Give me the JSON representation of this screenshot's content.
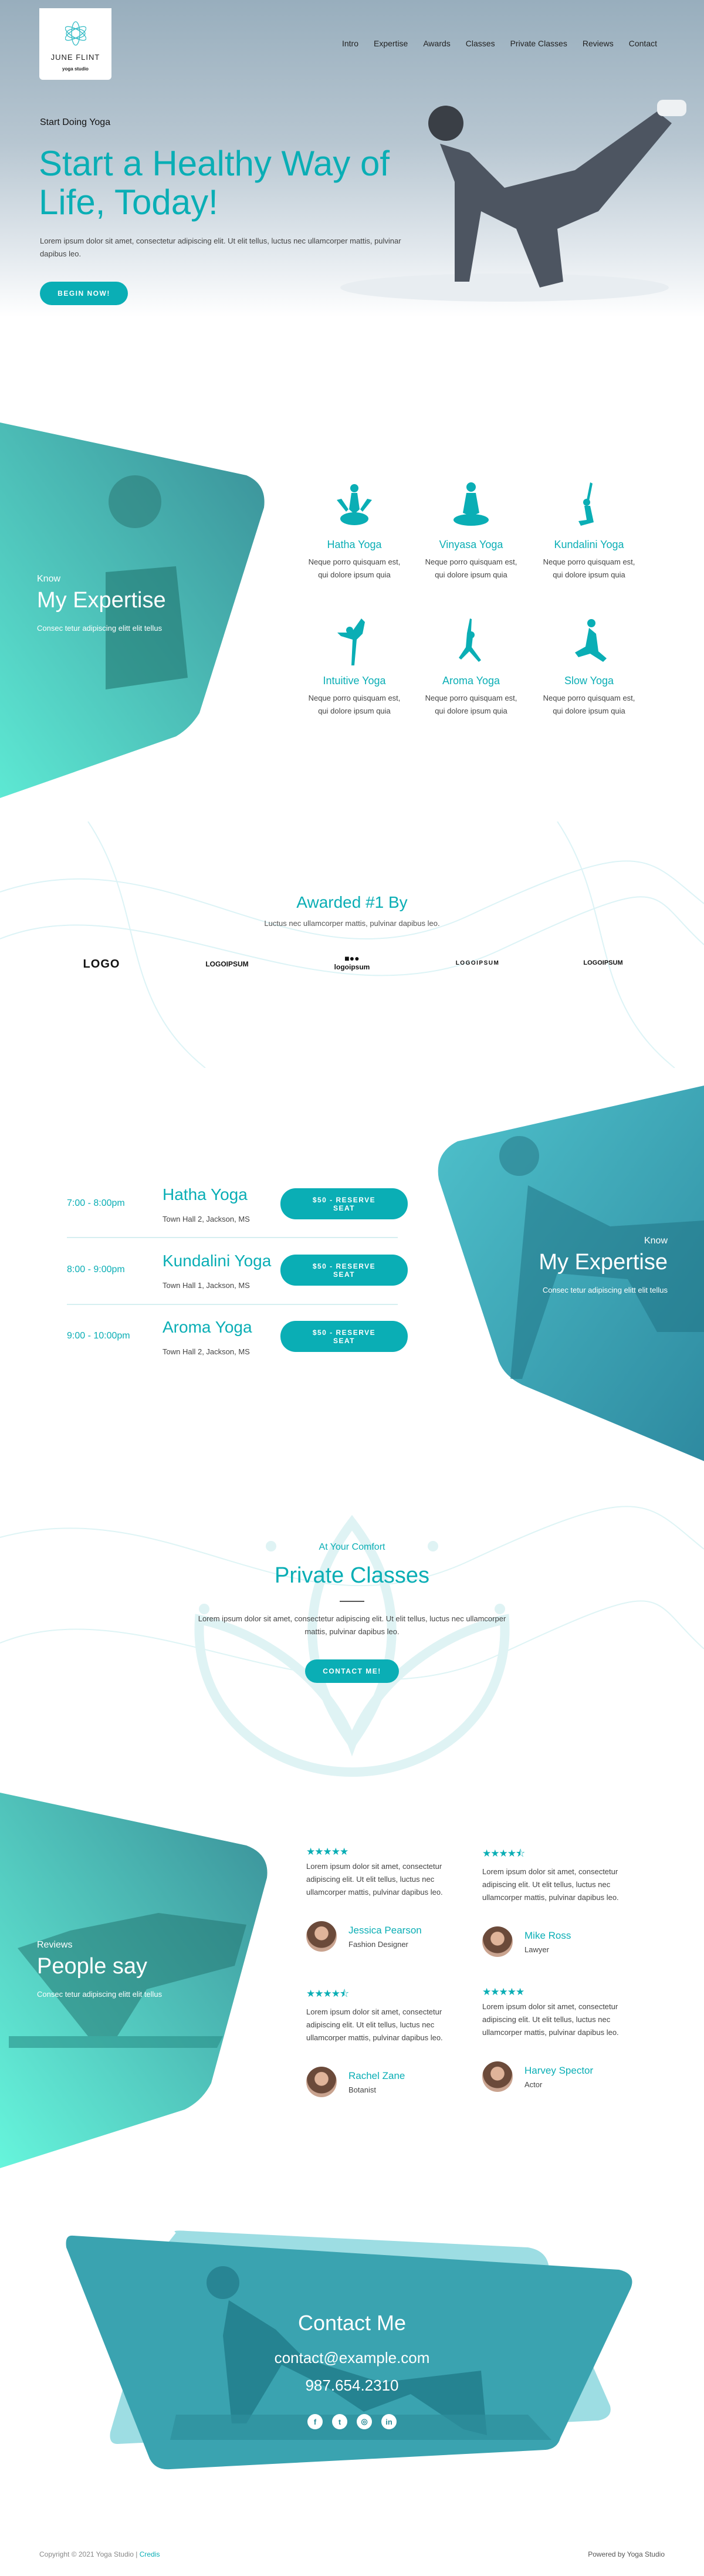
{
  "colors": {
    "accent": "#0aaeb5",
    "panel_teal": "#2fb3a7"
  },
  "brand": {
    "name": "JUNE FLINT",
    "tagline": "yoga studio",
    "icon": "mandala-icon"
  },
  "nav": [
    "Intro",
    "Expertise",
    "Awards",
    "Classes",
    "Private Classes",
    "Reviews",
    "Contact"
  ],
  "hero": {
    "eyebrow": "Start Doing Yoga",
    "title": "Start a Healthy Way of Life, Today!",
    "text": "Lorem ipsum dolor sit amet, consectetur adipiscing elit. Ut elit tellus, luctus nec ullamcorper mattis, pulvinar dapibus leo.",
    "button": "BEGIN NOW!"
  },
  "expertise": {
    "eyebrow": "Know",
    "title": "My Expertise",
    "subtitle": "Consec tetur adipiscing elitt elit tellus",
    "items": [
      {
        "title": "Hatha Yoga",
        "text": "Neque porro quisquam est, qui dolore ipsum quia",
        "icon": "lotus-pose-icon"
      },
      {
        "title": "Vinyasa Yoga",
        "text": "Neque porro quisquam est, qui dolore ipsum quia",
        "icon": "meditation-icon"
      },
      {
        "title": "Kundalini Yoga",
        "text": "Neque porro quisquam est, qui dolore ipsum quia",
        "icon": "mermaid-pose-icon"
      },
      {
        "title": "Intuitive Yoga",
        "text": "Neque porro quisquam est, qui dolore ipsum quia",
        "icon": "dancer-pose-icon"
      },
      {
        "title": "Aroma Yoga",
        "text": "Neque porro quisquam est, qui dolore ipsum quia",
        "icon": "warrior-pose-icon"
      },
      {
        "title": "Slow Yoga",
        "text": "Neque porro quisquam est, qui dolore ipsum quia",
        "icon": "pigeon-pose-icon"
      }
    ]
  },
  "awards": {
    "title": "Awarded #1 By",
    "subtitle": "Luctus nec ullamcorper mattis, pulvinar dapibus leo.",
    "logos": [
      "LOGO",
      "LOGOIPSUM",
      "logoipsum",
      "LOGOIPSUM",
      "LOGOIPSUM"
    ]
  },
  "classes": {
    "rows": [
      {
        "time": "7:00 - 8:00pm",
        "title": "Hatha Yoga",
        "location": "Town Hall 2, Jackson, MS",
        "button": "$50 - RESERVE SEAT"
      },
      {
        "time": "8:00 - 9:00pm",
        "title": "Kundalini Yoga",
        "location": "Town Hall 1, Jackson, MS",
        "button": "$50 - RESERVE SEAT"
      },
      {
        "time": "9:00 - 10:00pm",
        "title": "Aroma Yoga",
        "location": "Town Hall 2, Jackson, MS",
        "button": "$50 - RESERVE SEAT"
      }
    ],
    "panel": {
      "eyebrow": "Know",
      "title": "My Expertise",
      "subtitle": "Consec tetur adipiscing elitt elit tellus"
    }
  },
  "private": {
    "eyebrow": "At Your Comfort",
    "title": "Private Classes",
    "text": "Lorem ipsum dolor sit amet, consectetur adipiscing elit. Ut elit tellus, luctus nec ullamcorper mattis, pulvinar dapibus leo.",
    "button": "CONTACT ME!"
  },
  "reviews": {
    "eyebrow": "Reviews",
    "title": "People say",
    "subtitle": "Consec tetur adipiscing elitt elit tellus",
    "items": [
      {
        "rating": 5,
        "stars": "★★★★★",
        "text": "Lorem ipsum dolor sit amet, consectetur adipiscing elit. Ut elit tellus, luctus nec ullamcorper mattis, pulvinar dapibus leo.",
        "name": "Jessica Pearson",
        "role": "Fashion Designer"
      },
      {
        "rating": 4.5,
        "stars": "★★★★⯪",
        "text": "Lorem ipsum dolor sit amet, consectetur adipiscing elit. Ut elit tellus, luctus nec ullamcorper mattis, pulvinar dapibus leo.",
        "name": "Mike Ross",
        "role": "Lawyer"
      },
      {
        "rating": 4.5,
        "stars": "★★★★⯪",
        "text": "Lorem ipsum dolor sit amet, consectetur adipiscing elit. Ut elit tellus, luctus nec ullamcorper mattis, pulvinar dapibus leo.",
        "name": "Rachel Zane",
        "role": "Botanist"
      },
      {
        "rating": 5,
        "stars": "★★★★★",
        "text": "Lorem ipsum dolor sit amet, consectetur adipiscing elit. Ut elit tellus, luctus nec ullamcorper mattis, pulvinar dapibus leo.",
        "name": "Harvey Spector",
        "role": "Actor"
      }
    ]
  },
  "contact": {
    "title": "Contact Me",
    "email": "contact@example.com",
    "phone": "987.654.2310",
    "social": [
      {
        "icon": "facebook-icon",
        "glyph": "f"
      },
      {
        "icon": "twitter-icon",
        "glyph": "t"
      },
      {
        "icon": "instagram-icon",
        "glyph": "◎"
      },
      {
        "icon": "linkedin-icon",
        "glyph": "in"
      }
    ]
  },
  "footer": {
    "copyright": "Copyright © 2021 Yoga Studio |",
    "credits": "Credis",
    "powered": "Powered by Yoga Studio"
  }
}
